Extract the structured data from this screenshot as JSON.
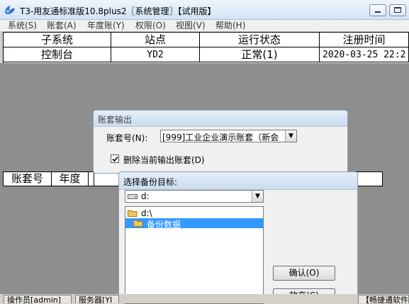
{
  "window": {
    "title": "T3-用友通标准版10.8plus2〖系统管理〗【试用版】"
  },
  "menu": [
    "系统(S)",
    "账套(A)",
    "年度账(Y)",
    "权限(O)",
    "视图(V)",
    "帮助(H)"
  ],
  "subsystems": {
    "columns": [
      "子系统",
      "站点",
      "运行状态",
      "注册时间"
    ],
    "rows": [
      [
        "控制台",
        "YD2",
        "正常(1)",
        "2020-03-25 22:2"
      ]
    ]
  },
  "accounts": {
    "columns": [
      "账套号",
      "年度"
    ]
  },
  "status": {
    "operator": "操作员[admin]",
    "server": "服务器[YI",
    "right": "【畅捷通软件"
  },
  "export_dialog": {
    "title": "账套输出",
    "account_label": "账套号(N):",
    "account_value": "[999]工业企业演示账套（新会",
    "delete_label": "删除当前输出账套(D)",
    "delete_checked": true
  },
  "backup_dialog": {
    "title": "选择备份目标:",
    "drive": "d:",
    "folders": [
      "d:\\",
      "备份数据"
    ],
    "selected_folder": "备份数据",
    "ok_label": "确认(O)",
    "cancel_label": "放弃(C)"
  },
  "colors": {
    "selection": "#3399ff",
    "workspace": "#8e8e8e",
    "folder": "#f0c75a"
  }
}
